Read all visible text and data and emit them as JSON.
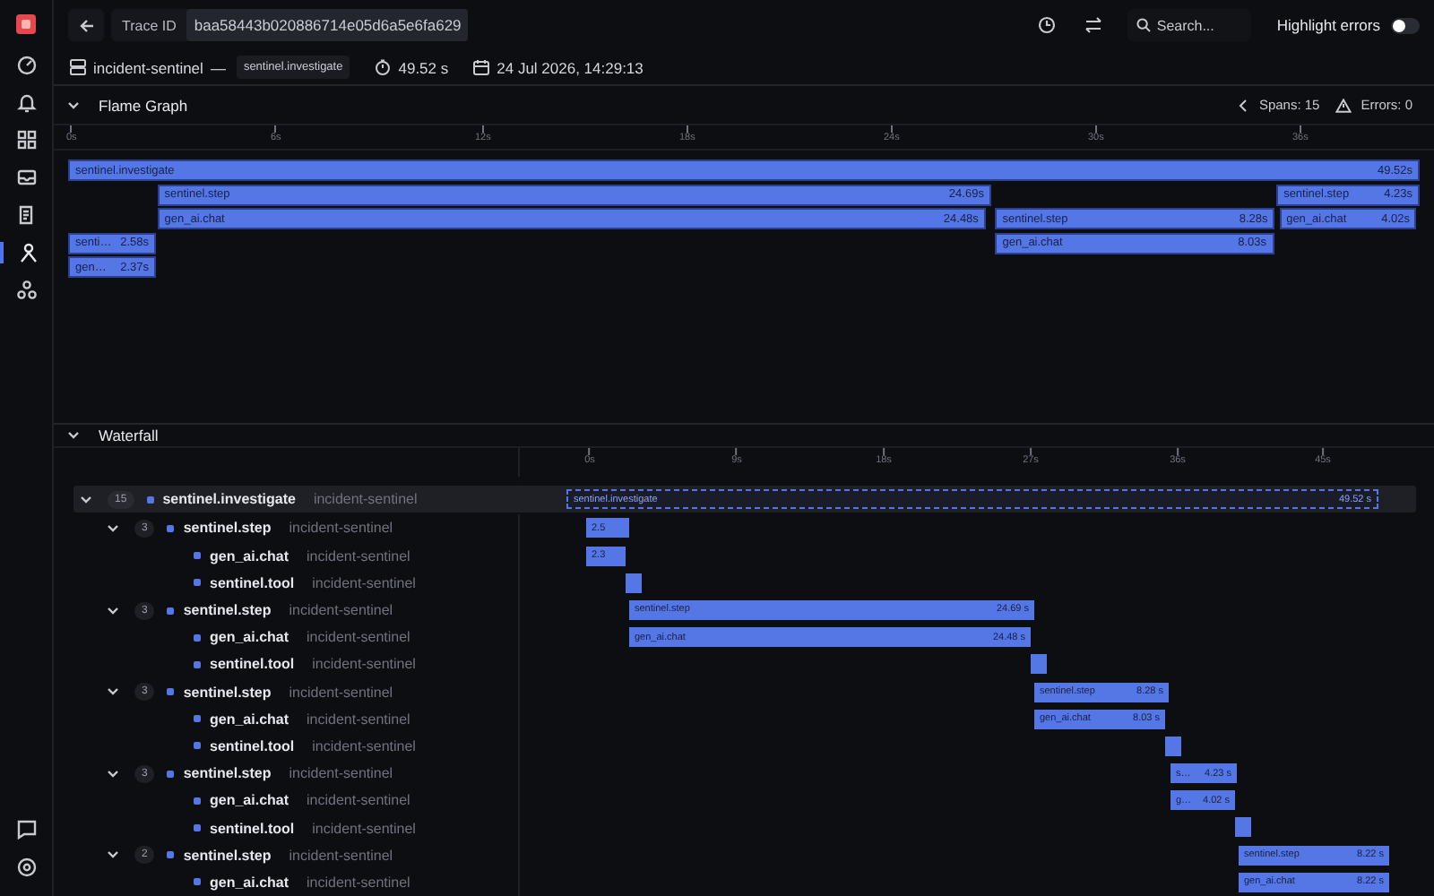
{
  "header": {
    "trace_id_label": "Trace ID",
    "trace_id": "baa58443b020886714e05d6a5e6fa629",
    "search": {
      "placeholder": "Search..."
    },
    "highlight_errors": {
      "label": "Highlight errors",
      "on": false
    }
  },
  "summary": {
    "service": "incident-sentinel",
    "separator": "—",
    "root_span": "sentinel.investigate",
    "duration": "49.52 s",
    "timestamp": "24 Jul 2026, 14:29:13"
  },
  "flame_graph": {
    "title": "Flame Graph",
    "expanded": true,
    "spans_count": "Spans: 15",
    "errors_count": "Errors: 0",
    "ticks": [
      "0s",
      "6s",
      "12s",
      "18s",
      "24s",
      "30s",
      "36s"
    ],
    "rows": [
      {
        "bars": [
          {
            "label": "sentinel.investigate",
            "duration": "49.52s"
          }
        ]
      },
      {
        "bars": [
          {
            "label": "sentinel.step",
            "duration": "24.69s"
          },
          {
            "label": "sentinel.step",
            "duration": "4.23s"
          }
        ]
      },
      {
        "bars": [
          {
            "label": "gen_ai.chat",
            "duration": "24.48s"
          },
          {
            "label": "sentinel.step",
            "duration": "8.28s"
          },
          {
            "label": "gen_ai.chat",
            "duration": "4.02s"
          }
        ]
      },
      {
        "bars": [
          {
            "label": "senti…",
            "duration": "2.58s"
          },
          {
            "label": "gen_ai.chat",
            "duration": "8.03s"
          }
        ]
      },
      {
        "bars": [
          {
            "label": "gen…",
            "duration": "2.37s"
          }
        ]
      }
    ]
  },
  "waterfall": {
    "title": "Waterfall",
    "expanded": true,
    "ticks": [
      "0s",
      "9s",
      "18s",
      "27s",
      "36s",
      "45s"
    ],
    "spans": [
      {
        "name": "sentinel.investigate",
        "service": "incident-sentinel",
        "count": "15",
        "expanded": true,
        "selected": true,
        "bar_label": "sentinel.investigate",
        "bar_duration": "49.52 s",
        "children": [
          {
            "name": "sentinel.step",
            "service": "incident-sentinel",
            "count": "3",
            "expanded": true,
            "selected": false,
            "bar_duration": "2.5",
            "children": [
              {
                "name": "gen_ai.chat",
                "service": "incident-sentinel",
                "selected": false,
                "bar_duration": "2.3"
              },
              {
                "name": "sentinel.tool",
                "service": "incident-sentinel",
                "selected": false
              }
            ]
          },
          {
            "name": "sentinel.step",
            "service": "incident-sentinel",
            "count": "3",
            "expanded": true,
            "selected": false,
            "bar_label": "sentinel.step",
            "bar_duration": "24.69 s",
            "children": [
              {
                "name": "gen_ai.chat",
                "service": "incident-sentinel",
                "selected": false,
                "bar_label": "gen_ai.chat",
                "bar_duration": "24.48 s"
              },
              {
                "name": "sentinel.tool",
                "service": "incident-sentinel",
                "selected": false
              }
            ]
          },
          {
            "name": "sentinel.step",
            "service": "incident-sentinel",
            "count": "3",
            "expanded": true,
            "selected": false,
            "bar_label": "sentinel.step",
            "bar_duration": "8.28 s",
            "children": [
              {
                "name": "gen_ai.chat",
                "service": "incident-sentinel",
                "selected": false,
                "bar_label": "gen_ai.chat",
                "bar_duration": "8.03 s"
              },
              {
                "name": "sentinel.tool",
                "service": "incident-sentinel",
                "selected": false
              }
            ]
          },
          {
            "name": "sentinel.step",
            "service": "incident-sentinel",
            "count": "3",
            "expanded": true,
            "selected": false,
            "bar_label": "s…",
            "bar_duration": "4.23 s",
            "children": [
              {
                "name": "gen_ai.chat",
                "service": "incident-sentinel",
                "selected": false,
                "bar_label": "g…",
                "bar_duration": "4.02 s"
              },
              {
                "name": "sentinel.tool",
                "service": "incident-sentinel",
                "selected": false
              }
            ]
          },
          {
            "name": "sentinel.step",
            "service": "incident-sentinel",
            "count": "2",
            "expanded": true,
            "selected": false,
            "bar_label": "sentinel.step",
            "bar_duration": "8.22 s",
            "children": [
              {
                "name": "gen_ai.chat",
                "service": "incident-sentinel",
                "selected": false,
                "bar_label": "gen_ai.chat",
                "bar_duration": "8.22 s"
              }
            ]
          }
        ]
      }
    ]
  }
}
